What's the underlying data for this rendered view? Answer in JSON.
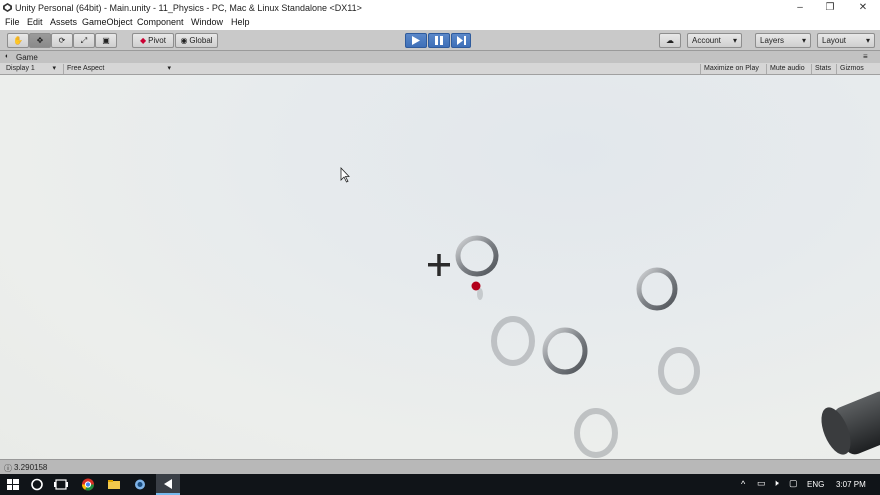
{
  "window": {
    "title": "Unity Personal (64bit) - Main.unity - 11_Physics - PC, Mac & Linux Standalone <DX11>"
  },
  "menu": [
    "File",
    "Edit",
    "Assets",
    "GameObject",
    "Component",
    "Window",
    "Help"
  ],
  "toolbar": {
    "pivot": "Pivot",
    "global": "Global",
    "account": "Account",
    "layers": "Layers",
    "layout": "Layout"
  },
  "game_tab": {
    "label": "Game"
  },
  "game_bar": {
    "display": "Display 1",
    "aspect": "Free Aspect",
    "maximize": "Maximize on Play",
    "mute": "Mute audio",
    "stats": "Stats",
    "gizmos": "Gizmos"
  },
  "status": {
    "text": "3.290158"
  },
  "taskbar": {
    "lang": "ENG",
    "time": "3:07 PM"
  },
  "colors": {
    "play_accent": "#3e6fb8",
    "sphere": "#b3001a"
  }
}
